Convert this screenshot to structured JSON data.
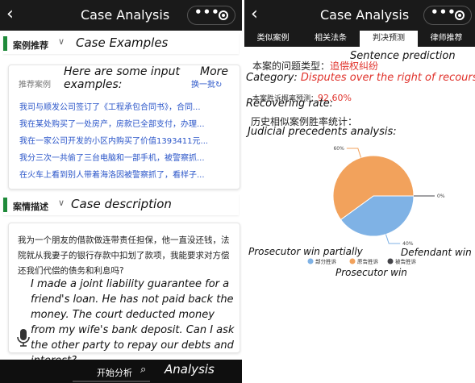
{
  "left": {
    "title": "Case Analysis",
    "back_icon": "chevron-left-icon",
    "more_icon": "more-dots-icon",
    "target_icon": "target-icon",
    "examples_header": {
      "cn": "案例推荐",
      "en": "Case Examples"
    },
    "examples_card": {
      "label_cn": "推荐案例",
      "label_en": "Here are some input examples:",
      "more_en": "More",
      "more_cn": "换一批",
      "refresh_icon": "refresh-icon",
      "items": [
        "我司与顺发公司签订了《工程承包合同书》，合同...",
        "我在某处购买了一处房产，房款已全部支付，办理...",
        "我在一家公司开发的小区内购买了价值1393411元...",
        "我分三次一共偷了三台电脑和一部手机，被警察抓...",
        "在火车上看到别人带着海洛因被警察抓了，看样子..."
      ]
    },
    "description_header": {
      "cn": "案情描述",
      "en": "Case description"
    },
    "description_card": {
      "text_cn": "我为一个朋友的借款做连带责任担保，他一直没还钱，法院就从我妻子的银行存款中扣划了款项，我能要求对方偿还我们代偿的债务和利息吗?",
      "text_en": "I made a joint liability guarantee for a friend's loan. He has not paid back the money. The court deducted money from my wife's bank deposit. Can I ask the other party to repay our debts and interest?",
      "mic_icon": "microphone-icon"
    },
    "bottom": {
      "label_cn": "开始分析",
      "search_icon": "search-icon",
      "label_en": "Analysis"
    }
  },
  "right": {
    "title": "Case Analysis",
    "back_icon": "chevron-left-icon",
    "more_icon": "more-dots-icon",
    "target_icon": "target-icon",
    "tabs": [
      {
        "label": "类似案例"
      },
      {
        "label": "相关法条"
      },
      {
        "label": "判决预测"
      },
      {
        "label": "律师推荐"
      }
    ],
    "active_tab": "判决预测",
    "sentence_en": "Sentence prediction",
    "category_cn_label": "本案的问题类型：",
    "category_cn_value": "追偿权纠纷",
    "category_en_label": "Category:",
    "category_en_value": "Disputes over the right of recourse",
    "rate_cn_label": "本案胜诉概率预测：",
    "rate_value": "92.60%",
    "rate_en": "Recovering rate:",
    "stats_cn": "历史相似案例胜率统计：",
    "stats_en": "Judicial precedents analysis:",
    "pie_en_labels": {
      "partial": "Prosecutor win partially",
      "defendant": "Defendant win",
      "win": "Prosecutor win"
    }
  },
  "chart_data": {
    "type": "pie",
    "categories": [
      "部分胜诉",
      "原告胜诉",
      "被告胜诉"
    ],
    "values": [
      40,
      60,
      0
    ],
    "value_labels": [
      "40%",
      "60%",
      "0%"
    ],
    "colors": [
      "#7fb2e5",
      "#f2a25c",
      "#434348"
    ],
    "legend_position": "bottom"
  }
}
